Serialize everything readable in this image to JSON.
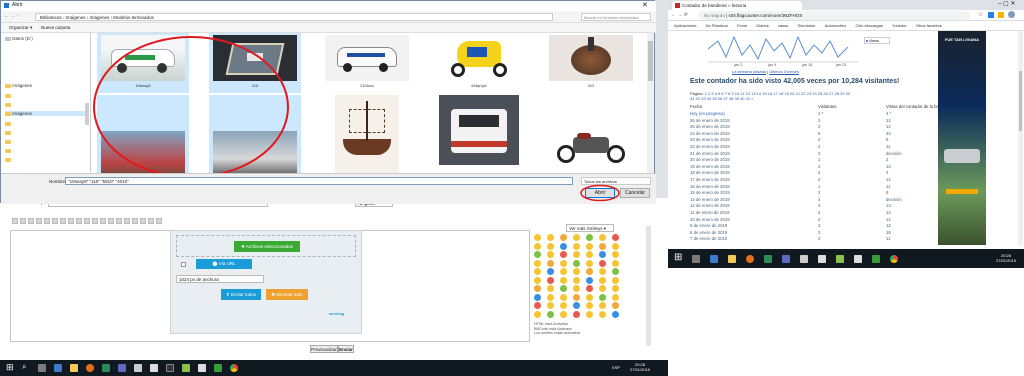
{
  "dialog": {
    "title": "Abrir",
    "breadcrumb": [
      "Bibliotecas",
      "Imágenes",
      "Imágenes",
      "Modelos terminados"
    ],
    "search_placeholder": "Buscar en Modelos terminados",
    "organize_label": "Organizar ▾",
    "new_folder_label": "Nueva carpeta",
    "nav_items": [
      "Datos (D:)",
      "Imágenes",
      "Imágenes"
    ],
    "files": [
      {
        "name": "10seay8",
        "selected": true
      },
      {
        "name": "110",
        "selected": true
      },
      {
        "name": "210locc",
        "selected": false
      },
      {
        "name": "646p1y6",
        "selected": false
      },
      {
        "name": "312",
        "selected": false
      },
      {
        "name": "",
        "selected": true
      },
      {
        "name": "",
        "selected": true
      },
      {
        "name": "",
        "selected": false
      },
      {
        "name": "",
        "selected": false
      },
      {
        "name": "",
        "selected": false
      }
    ],
    "filename_label": "Nombre:",
    "filename_value": "\"10seay8\" \"110\" \"5910\" \"4010\"",
    "filetype_value": "Todos los archivos",
    "open_button": "Abrir",
    "cancel_button": "Cancelar"
  },
  "forum": {
    "message_title_label": "Título del mensaje",
    "ninguna": "Ninguna",
    "upload_selected": "Archivos seleccionados",
    "via_url": "Vía URL",
    "resize_option": "1024 px de anchura",
    "send_all": "Enviar todos",
    "delete_all": "Eliminar todo",
    "more_smilies": "Ver más Smileys ▾",
    "status_lines": [
      "HTML está Activado",
      "BBCode está Activado",
      "Los smilies están activados"
    ],
    "preview_button": "Previsualizar",
    "send_button": "Enviar"
  },
  "browser": {
    "tab_title": "Contador de banderas » historia",
    "insecure_label": "No seguro",
    "url": "s04.flagcounter.com/more/3NZFHOX",
    "bookmarks": [
      "Aplicaciones",
      "De Plásticos",
      "Foros",
      "Diarios",
      "casas",
      "Simulador",
      "Automoviles",
      "Otro descargas",
      "Youtube",
      "Otros favoritos"
    ],
    "chart_caption_1": "La semana pasada",
    "chart_caption_2": "Últimos 3 meses",
    "chart_x_labels": [
      "jan 2",
      "jan 9",
      "jan 16",
      "jan 23"
    ],
    "views_legend": "Views",
    "headline": "Este contador ha sido visto 42,005 veces por 10,284 visitantes!",
    "pages_label": "Página:",
    "pages_line1": "1 2 3 4 5 6 7 8 9 10 11 12 13 14 15 16 17 18 19 20 21 22 23 24 25 26 27 28 29 30",
    "pages_line2": "31 32 33 34 35 36 37 38 39 40 41 »",
    "col_headers": [
      "Fecha",
      "Visitantes",
      "Vistas del contador de la bandera"
    ],
    "rows": [
      {
        "date": "Hoy (en progreso)",
        "visitors": "1 *",
        "views": "4 *"
      },
      {
        "date": "26 de enero de 2019",
        "visitors": "2",
        "views": "12"
      },
      {
        "date": "25 de enero de 2019",
        "visitors": "2",
        "views": "12"
      },
      {
        "date": "24 de enero de 2019",
        "visitors": "6",
        "views": "24"
      },
      {
        "date": "23 de enero de 2019",
        "visitors": "2",
        "views": "9"
      },
      {
        "date": "22 de enero de 2019",
        "visitors": "2",
        "views": "11"
      },
      {
        "date": "21 de enero de 2019",
        "visitors": "3",
        "views": "decisión"
      },
      {
        "date": "20 de enero de 2019",
        "visitors": "1",
        "views": "2"
      },
      {
        "date": "19 de enero de 2019",
        "visitors": "2",
        "views": "12"
      },
      {
        "date": "18 de enero de 2019",
        "visitors": "2",
        "views": "3"
      },
      {
        "date": "17 de enero de 2019",
        "visitors": "2",
        "views": "12"
      },
      {
        "date": "16 de enero de 2019",
        "visitors": "1",
        "views": "11"
      },
      {
        "date": "15 de enero de 2019",
        "visitors": "2",
        "views": "9"
      },
      {
        "date": "14 de enero de 2019",
        "visitors": "4",
        "views": "decisión"
      },
      {
        "date": "12 de enero de 2019",
        "visitors": "3",
        "views": "13"
      },
      {
        "date": "11 de enero de 2019",
        "visitors": "2",
        "views": "14"
      },
      {
        "date": "10 de enero de 2019",
        "visitors": "2",
        "views": "12"
      },
      {
        "date": "9 de enero de 2019",
        "visitors": "3",
        "views": "12"
      },
      {
        "date": "8 de enero de 2019",
        "visitors": "3",
        "views": "18"
      },
      {
        "date": "7 de enero de 2019",
        "visitors": "2",
        "views": "11"
      }
    ],
    "ad_text": "FUE TAN LIVIANA"
  },
  "taskbar_left": {
    "time": "20:28",
    "date": "27/01/2019",
    "lang": "ESP"
  },
  "taskbar_right": {
    "time": "20:28",
    "date": "27/01/2019"
  },
  "colors": {
    "accent": "#0078d7",
    "selection": "#cce8ff",
    "annotation": "#e0191e",
    "upload_green": "#3aaa35",
    "upload_blue": "#1a9cd8",
    "upload_orange": "#f0a030"
  }
}
